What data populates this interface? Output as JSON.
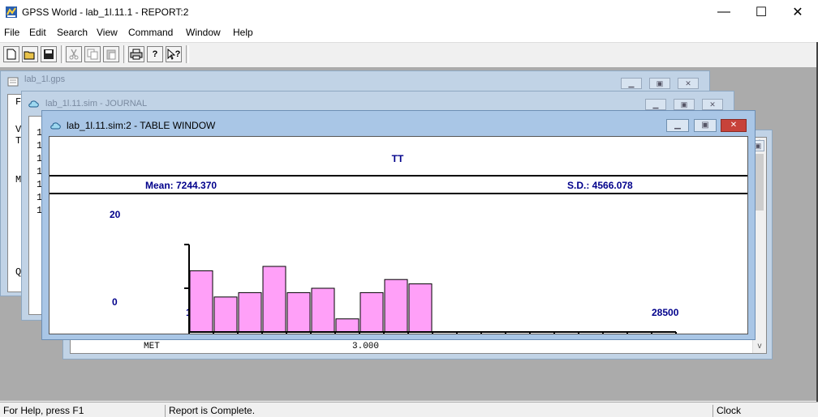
{
  "window": {
    "title": "GPSS World - lab_1l.11.1  -  REPORT:2",
    "minimize": "—",
    "maximize": "☐",
    "close": "✕"
  },
  "menu": [
    "File",
    "Edit",
    "Search",
    "View",
    "Command",
    "Window",
    "Help"
  ],
  "toolbar": {
    "new": "new-file-icon",
    "open": "open-folder-icon",
    "save": "save-icon",
    "cut": "cut-icon",
    "copy": "copy-icon",
    "paste": "paste-icon",
    "print": "print-icon",
    "help": "help-icon",
    "context_help": "context-help-icon",
    "help_glyph": "?",
    "context_help_glyph": "?"
  },
  "windows": {
    "model": {
      "title": "lab_1l.gps",
      "fragments": [
        "F",
        "V",
        "T",
        "M",
        "Q"
      ]
    },
    "journal": {
      "title": "lab_1l.11.sim  -  JOURNAL",
      "fragments": [
        "1",
        "1",
        "1",
        "1",
        "1",
        "1",
        "1"
      ]
    },
    "report": {
      "row_label": "MET",
      "row_value": "3.000"
    },
    "table": {
      "title": "lab_1l.11.sim:2  -  TABLE WINDOW",
      "table_name": "TT",
      "mean_text": "Mean: 7244.370",
      "sd_text": "S.D.: 4566.078",
      "y_max_label": "20",
      "y_min_label": "0",
      "x_min_label": "1500",
      "x_max_label": "28500"
    }
  },
  "chart_data": {
    "type": "bar",
    "title": "TT",
    "ylim": [
      0,
      20
    ],
    "xlim": [
      1500,
      28500
    ],
    "yticks": [
      "20",
      "0"
    ],
    "xticks": [
      "1500",
      "28500"
    ],
    "bin_count": 20,
    "values": [
      14,
      8,
      9,
      15,
      9,
      10,
      3,
      9,
      12,
      11
    ],
    "bar_color": "#ffa0f8",
    "grid": false
  },
  "status": {
    "help": "For Help, press F1",
    "message": "Report is Complete.",
    "clock": "Clock"
  },
  "colors": {
    "chart_text": "#00008b",
    "bar": "#ffa0f8",
    "mdi_background": "#ababab",
    "active_title": "#a9c6e6",
    "inactive_title": "#c1d3e6",
    "close_button": "#c7423a"
  }
}
